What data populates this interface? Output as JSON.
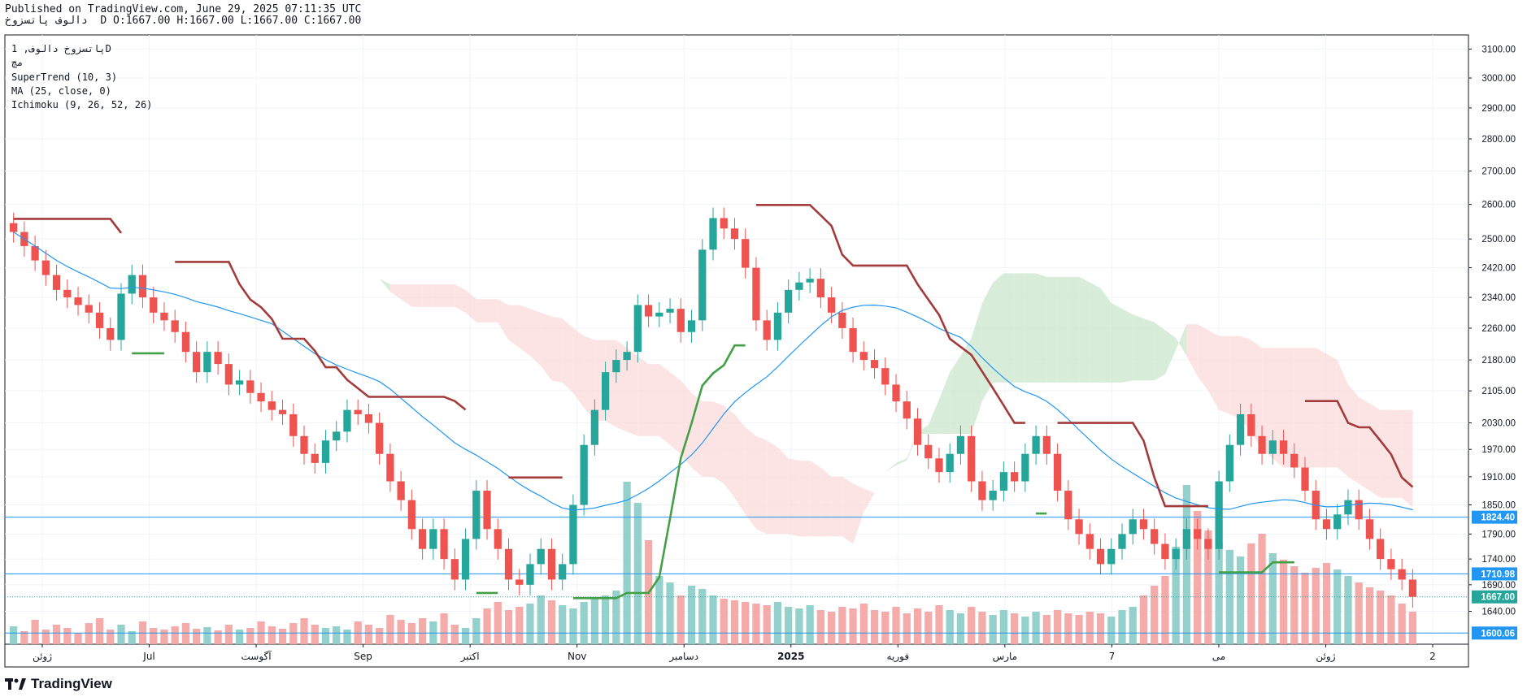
{
  "header": {
    "published_line": "Published on TradingView.com, June 29, 2025 07:11:35 UTC",
    "ohlc_line": "دالوف پاتسزوخ  D O:1667.00 H:1667.00 L:1667.00 C:1667.00"
  },
  "legend": {
    "symbol_line": "پاتسزوخ دالوف, 1D",
    "sub_line": "مچ",
    "indicators": [
      "SuperTrend (10, 3)",
      "MA (25, close, 0)",
      "Ichimoku (9, 26, 52, 26)"
    ]
  },
  "footer": {
    "brand": "TradingView"
  },
  "colors": {
    "bull": "#26a69a",
    "bear": "#ef5350",
    "supertrend_up": "#43a047",
    "supertrend_down": "#a33b3b",
    "ma": "#2196f3",
    "cloud_green": "#c8e6c9",
    "cloud_red": "#fbd9d9",
    "hline": "#2196f3",
    "last_price": "#26a69a"
  },
  "chart_data": {
    "type": "candlestick",
    "scale": "log",
    "timeframe": "1D",
    "x_ticks": [
      "ژوئن",
      "Jul",
      "آگوست",
      "Sep",
      "اکتبر",
      "Nov",
      "دسامبر",
      "2025",
      "فوریه",
      "مارس",
      "7",
      "می",
      "ژوئن",
      "2"
    ],
    "y_ticks": [
      3100,
      3000,
      2900,
      2800,
      2700,
      2600,
      2500,
      2420,
      2340,
      2260,
      2180,
      2105,
      2030,
      1970,
      1910,
      1850,
      1790,
      1740,
      1690,
      1640
    ],
    "y_range": [
      1580,
      3150
    ],
    "horizontal_lines": [
      {
        "value": 1824.4,
        "label": "1824.40"
      },
      {
        "value": 1710.98,
        "label": "1710.98"
      },
      {
        "value": 1600.06,
        "label": "1600.06"
      }
    ],
    "last_price": {
      "value": 1667.0,
      "label": "1667.00"
    },
    "close_series": [
      2520,
      2480,
      2440,
      2400,
      2360,
      2340,
      2320,
      2300,
      2260,
      2230,
      2350,
      2400,
      2340,
      2300,
      2280,
      2250,
      2200,
      2150,
      2200,
      2170,
      2120,
      2130,
      2100,
      2080,
      2060,
      2050,
      2000,
      1960,
      1940,
      1990,
      2010,
      2060,
      2050,
      2030,
      1960,
      1900,
      1860,
      1800,
      1760,
      1800,
      1740,
      1700,
      1780,
      1880,
      1800,
      1760,
      1700,
      1690,
      1730,
      1760,
      1700,
      1730,
      1850,
      1980,
      2060,
      2150,
      2180,
      2200,
      2320,
      2290,
      2300,
      2310,
      2250,
      2280,
      2470,
      2560,
      2530,
      2500,
      2420,
      2280,
      2230,
      2300,
      2360,
      2380,
      2390,
      2340,
      2300,
      2260,
      2200,
      2180,
      2160,
      2120,
      2080,
      2040,
      1980,
      1950,
      1920,
      1960,
      2000,
      1900,
      1860,
      1880,
      1920,
      1900,
      1960,
      2000,
      1960,
      1880,
      1820,
      1790,
      1760,
      1730,
      1760,
      1790,
      1820,
      1800,
      1770,
      1740,
      1760,
      1800,
      1780,
      1760,
      1900,
      1980,
      2050,
      2000,
      1960,
      1990,
      1960,
      1930,
      1880,
      1820,
      1800,
      1830,
      1860,
      1820,
      1780,
      1740,
      1720,
      1700,
      1667
    ],
    "volume_range": [
      0,
      1000
    ],
    "volume_series": [
      110,
      80,
      150,
      90,
      120,
      100,
      70,
      130,
      160,
      90,
      120,
      80,
      140,
      100,
      90,
      110,
      130,
      95,
      105,
      85,
      120,
      90,
      100,
      140,
      110,
      95,
      130,
      160,
      120,
      100,
      110,
      90,
      140,
      120,
      100,
      180,
      150,
      130,
      160,
      140,
      190,
      120,
      100,
      160,
      220,
      260,
      210,
      230,
      250,
      300,
      270,
      240,
      220,
      260,
      280,
      300,
      330,
      1000,
      870,
      640,
      420,
      380,
      300,
      360,
      340,
      300,
      280,
      270,
      260,
      250,
      240,
      260,
      230,
      220,
      240,
      210,
      200,
      230,
      220,
      250,
      210,
      200,
      230,
      190,
      220,
      200,
      240,
      210,
      190,
      230,
      200,
      180,
      210,
      190,
      170,
      200,
      180,
      210,
      190,
      180,
      200,
      190,
      170,
      210,
      230,
      300,
      360,
      420,
      600,
      980,
      820,
      700,
      620,
      580,
      540,
      620,
      680,
      560,
      520,
      480,
      440,
      470,
      500,
      460,
      420,
      380,
      350,
      330,
      300,
      250,
      200
    ]
  }
}
